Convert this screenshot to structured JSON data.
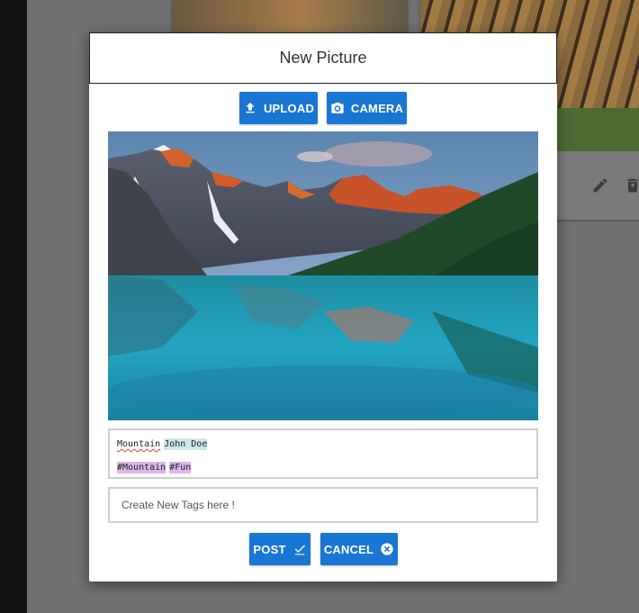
{
  "dialog": {
    "title": "New Picture",
    "upload_label": "UPLOAD",
    "camera_label": "CAMERA",
    "tags": {
      "line1": [
        "Mountain",
        "John Doe"
      ],
      "line2": [
        "#Mountain",
        "#Fun"
      ]
    },
    "new_tag_placeholder": "Create New Tags here !",
    "post_label": "POST",
    "cancel_label": "CANCEL"
  },
  "icons": {
    "upload": "upload-icon",
    "camera": "camera-icon",
    "post": "check-icon",
    "cancel": "close-circle-icon",
    "edit": "pencil-icon",
    "delete": "trash-icon"
  },
  "colors": {
    "primary": "#1976d2",
    "person_tag": "#cfe6ea",
    "hashtag": "#dcb6ea",
    "spellcheck": "#e53935"
  }
}
